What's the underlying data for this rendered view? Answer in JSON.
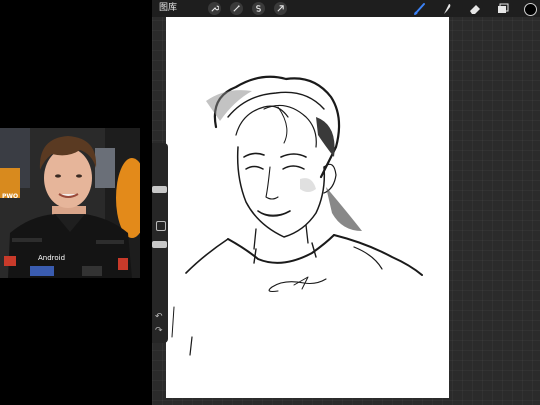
{
  "topbar": {
    "gallery_label": "图库",
    "actions": [
      {
        "name": "actions-wrench-icon"
      },
      {
        "name": "adjustments-wand-icon"
      },
      {
        "name": "selection-s-icon"
      },
      {
        "name": "transform-arrow-icon"
      }
    ],
    "tools": [
      {
        "name": "brush-icon",
        "active": true
      },
      {
        "name": "smudge-icon",
        "active": false
      },
      {
        "name": "eraser-icon",
        "active": false
      },
      {
        "name": "layers-icon",
        "active": false
      }
    ],
    "current_color": "#000000"
  },
  "sidebar": {
    "size_slider": "size-slider",
    "opacity_slider": "opacity-slider",
    "undo_glyph": "↶",
    "redo_glyph": "↷"
  },
  "reference_photo": {
    "logos": [
      "PWO",
      "Android"
    ]
  },
  "colors": {
    "active_tool": "#3b82f6",
    "workspace": "#2b2b2b",
    "topbar": "#1e1e1e",
    "canvas": "#ffffff"
  }
}
